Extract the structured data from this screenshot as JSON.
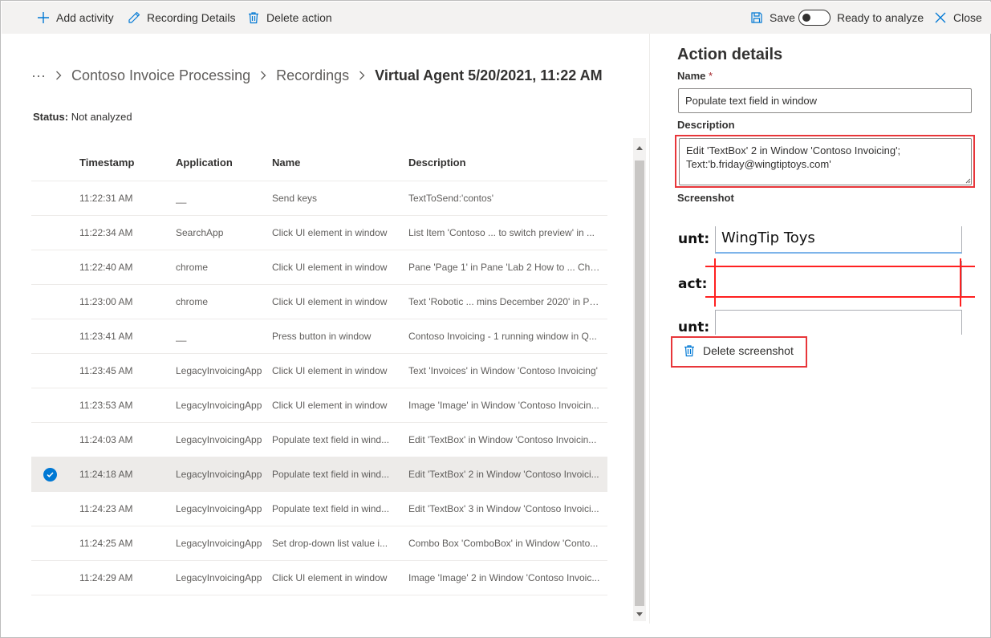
{
  "toolbar": {
    "add_activity": "Add activity",
    "recording_details": "Recording Details",
    "delete_action": "Delete action",
    "save": "Save",
    "ready_to_analyze": "Ready to analyze",
    "close": "Close"
  },
  "breadcrumb": {
    "ellipsis": "···",
    "items": [
      "Contoso Invoice Processing",
      "Recordings"
    ],
    "current": "Virtual Agent 5/20/2021, 11:22 AM"
  },
  "status": {
    "label": "Status:",
    "value": "Not analyzed"
  },
  "table": {
    "columns": [
      "Timestamp",
      "Application",
      "Name",
      "Description"
    ],
    "rows": [
      {
        "timestamp": "11:22:31 AM",
        "application": "__",
        "name": "Send keys",
        "description": "TextToSend:'contos'"
      },
      {
        "timestamp": "11:22:34 AM",
        "application": "SearchApp",
        "name": "Click UI element in window",
        "description": "List Item 'Contoso ... to switch preview' in ..."
      },
      {
        "timestamp": "11:22:40 AM",
        "application": "chrome",
        "name": "Click UI element in window",
        "description": "Pane 'Page 1' in Pane 'Lab 2 How to ... Chro..."
      },
      {
        "timestamp": "11:23:00 AM",
        "application": "chrome",
        "name": "Click UI element in window",
        "description": "Text 'Robotic ... mins December 2020' in Pa..."
      },
      {
        "timestamp": "11:23:41 AM",
        "application": "__",
        "name": "Press button in window",
        "description": "Contoso Invoicing - 1 running window in Q..."
      },
      {
        "timestamp": "11:23:45 AM",
        "application": "LegacyInvoicingApp",
        "name": "Click UI element in window",
        "description": "Text 'Invoices' in Window 'Contoso Invoicing'"
      },
      {
        "timestamp": "11:23:53 AM",
        "application": "LegacyInvoicingApp",
        "name": "Click UI element in window",
        "description": "Image 'Image' in Window 'Contoso Invoicin..."
      },
      {
        "timestamp": "11:24:03 AM",
        "application": "LegacyInvoicingApp",
        "name": "Populate text field in wind...",
        "description": "Edit 'TextBox' in Window 'Contoso Invoicin..."
      },
      {
        "timestamp": "11:24:18 AM",
        "application": "LegacyInvoicingApp",
        "name": "Populate text field in wind...",
        "description": "Edit 'TextBox' 2 in Window 'Contoso Invoici...",
        "selected": true
      },
      {
        "timestamp": "11:24:23 AM",
        "application": "LegacyInvoicingApp",
        "name": "Populate text field in wind...",
        "description": "Edit 'TextBox' 3 in Window 'Contoso Invoici..."
      },
      {
        "timestamp": "11:24:25 AM",
        "application": "LegacyInvoicingApp",
        "name": "Set drop-down list value i...",
        "description": "Combo Box 'ComboBox' in Window 'Conto..."
      },
      {
        "timestamp": "11:24:29 AM",
        "application": "LegacyInvoicingApp",
        "name": "Click UI element in window",
        "description": "Image 'Image' 2 in Window 'Contoso Invoic..."
      }
    ]
  },
  "panel": {
    "title": "Action details",
    "name_label": "Name",
    "required_mark": "*",
    "name_value": "Populate text field in window",
    "description_label": "Description",
    "description_value": "Edit 'TextBox' 2 in Window 'Contoso Invoicing';\nText:'b.friday@wingtiptoys.com'",
    "screenshot_label": "Screenshot",
    "screenshot": {
      "label1": "unt:",
      "field1_text": "WingTip Toys",
      "label2": "act:",
      "label3": "unt:"
    },
    "delete_screenshot": "Delete screenshot"
  },
  "colors": {
    "accent": "#0078d4",
    "highlight_border": "#e8363a",
    "selected_row": "#edebe9",
    "toolbar_bg": "#f3f2f1"
  },
  "icons": {
    "add": "plus-icon",
    "recording_details": "pencil-icon",
    "delete": "trash-icon",
    "save": "save-icon",
    "close": "close-icon",
    "breadcrumb_separator": "chevron-right-icon",
    "selected": "checkmark-icon"
  }
}
